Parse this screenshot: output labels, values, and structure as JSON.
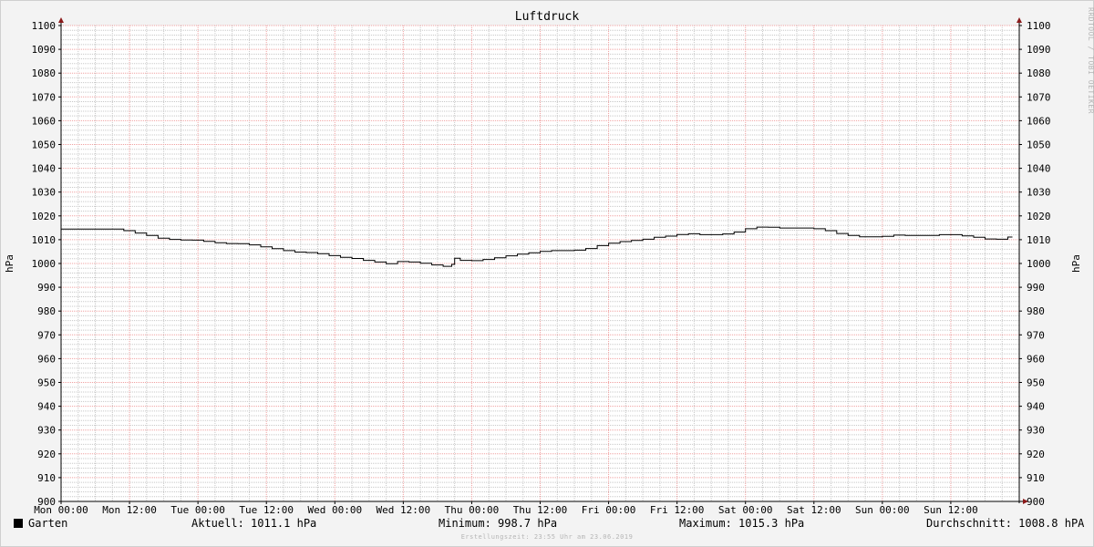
{
  "chart_data": {
    "type": "line",
    "title": "Luftdruck",
    "ylabel": "hPa",
    "ylabel_right": "hPa",
    "ylim": [
      900,
      1100
    ],
    "ytick_step": 10,
    "xlim_hours": [
      0,
      168
    ],
    "x_ticks": [
      {
        "hour": 0,
        "label": "Mon 00:00"
      },
      {
        "hour": 12,
        "label": "Mon 12:00"
      },
      {
        "hour": 24,
        "label": "Tue 00:00"
      },
      {
        "hour": 36,
        "label": "Tue 12:00"
      },
      {
        "hour": 48,
        "label": "Wed 00:00"
      },
      {
        "hour": 60,
        "label": "Wed 12:00"
      },
      {
        "hour": 72,
        "label": "Thu 00:00"
      },
      {
        "hour": 84,
        "label": "Thu 12:00"
      },
      {
        "hour": 96,
        "label": "Fri 00:00"
      },
      {
        "hour": 108,
        "label": "Fri 12:00"
      },
      {
        "hour": 120,
        "label": "Sat 00:00"
      },
      {
        "hour": 132,
        "label": "Sat 12:00"
      },
      {
        "hour": 144,
        "label": "Sun 00:00"
      },
      {
        "hour": 156,
        "label": "Sun 12:00"
      }
    ],
    "grid": true,
    "series": [
      {
        "name": "Garten",
        "color": "#000000",
        "x_hours": [
          0,
          9,
          11,
          13,
          15,
          17,
          19,
          21,
          23,
          25,
          27,
          29,
          31,
          33,
          35,
          37,
          39,
          41,
          43,
          45,
          47,
          49,
          51,
          53,
          55,
          57,
          59,
          61,
          63,
          65,
          67,
          68.5,
          69,
          70,
          72,
          74,
          76,
          78,
          80,
          82,
          84,
          86,
          88,
          90,
          92,
          94,
          96,
          98,
          100,
          102,
          104,
          106,
          108,
          110,
          112,
          114,
          116,
          118,
          120,
          122,
          124,
          126,
          128,
          130,
          132,
          134,
          136,
          138,
          140,
          142,
          144,
          146,
          148,
          150,
          152,
          154,
          156,
          158,
          160,
          162,
          164,
          166
        ],
        "values": [
          1014.5,
          1014.5,
          1013.8,
          1012.8,
          1011.8,
          1010.6,
          1010.1,
          1009.9,
          1009.8,
          1009.3,
          1008.7,
          1008.4,
          1008.3,
          1007.8,
          1007.0,
          1006.2,
          1005.4,
          1004.8,
          1004.6,
          1004.1,
          1003.3,
          1002.6,
          1002.1,
          1001.3,
          1000.6,
          999.9,
          1000.8,
          1000.6,
          1000.1,
          999.4,
          998.8,
          999.6,
          1002.2,
          1001.3,
          1001.2,
          1001.7,
          1002.4,
          1003.2,
          1003.9,
          1004.5,
          1005.1,
          1005.4,
          1005.4,
          1005.6,
          1006.3,
          1007.5,
          1008.5,
          1009.2,
          1009.7,
          1010.2,
          1011.0,
          1011.5,
          1012.2,
          1012.5,
          1012.1,
          1012.1,
          1012.4,
          1013.2,
          1014.6,
          1015.3,
          1015.2,
          1014.9,
          1014.9,
          1014.9,
          1014.6,
          1013.8,
          1012.6,
          1011.8,
          1011.2,
          1011.2,
          1011.4,
          1011.9,
          1011.8,
          1011.8,
          1011.8,
          1012.1,
          1012.1,
          1011.6,
          1011.0,
          1010.3,
          1010.2,
          1011.1
        ]
      }
    ]
  },
  "legend": {
    "series_name": "Garten",
    "aktuell": "Aktuell: 1011.1 hPa",
    "minimum": "Minimum: 998.7 hPa",
    "maximum": "Maximum: 1015.3 hPa",
    "durchschnitt": "Durchschnitt: 1008.8 hPA"
  },
  "footer": "Erstellungszeit: 23:55 Uhr am 23.06.2019",
  "watermark": "RRDTOOL / TOBI OETIKER",
  "colors": {
    "major_grid": "#f0a0a0",
    "minor_grid": "#c8c8c8",
    "axis": "#000000",
    "arrow": "#8b1a1a",
    "plot_background": "#ffffff",
    "page_background": "#f3f3f3"
  }
}
